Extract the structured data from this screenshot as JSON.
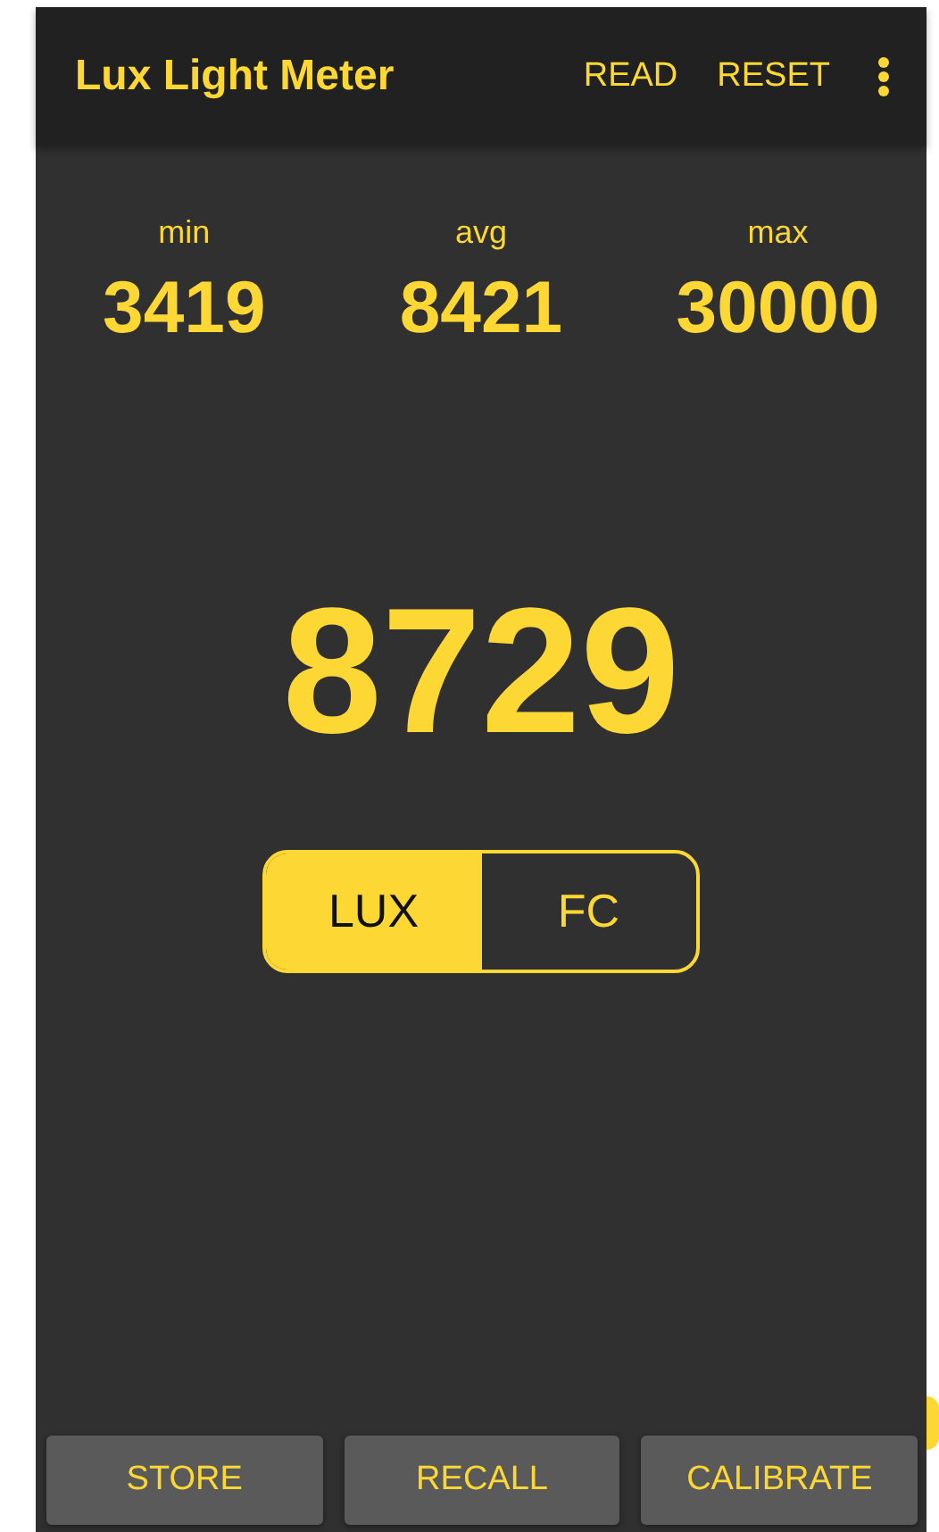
{
  "app_bar": {
    "title": "Lux Light Meter",
    "actions": [
      "READ",
      "RESET"
    ]
  },
  "stats": [
    {
      "label": "min",
      "value": "3419"
    },
    {
      "label": "avg",
      "value": "8421"
    },
    {
      "label": "max",
      "value": "30000"
    }
  ],
  "reading": "8729",
  "units": [
    {
      "label": "LUX",
      "selected": true
    },
    {
      "label": "FC",
      "selected": false
    }
  ],
  "buttons": [
    "STORE",
    "RECALL",
    "CALIBRATE"
  ]
}
